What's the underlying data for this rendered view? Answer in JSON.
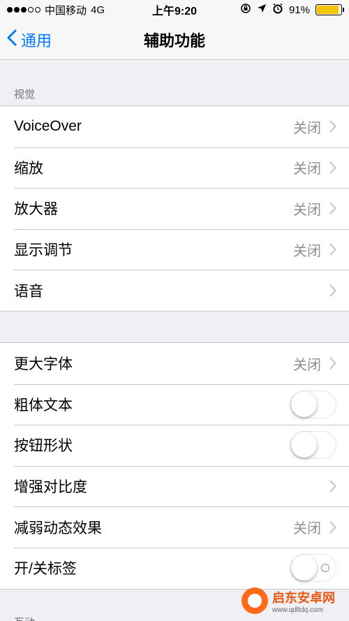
{
  "status_bar": {
    "carrier": "中国移动",
    "network": "4G",
    "time": "上午9:20",
    "battery_percent": "91%",
    "battery_level": 0.91,
    "signal_bars": 3,
    "icons": [
      "orientation-lock-icon",
      "location-arrow-icon",
      "alarm-icon"
    ]
  },
  "nav": {
    "back_label": "通用",
    "title": "辅助功能"
  },
  "sections": [
    {
      "header": "视觉",
      "rows": [
        {
          "label": "VoiceOver",
          "value": "关闭",
          "accessory": "chevron"
        },
        {
          "label": "缩放",
          "value": "关闭",
          "accessory": "chevron"
        },
        {
          "label": "放大器",
          "value": "关闭",
          "accessory": "chevron"
        },
        {
          "label": "显示调节",
          "value": "关闭",
          "accessory": "chevron"
        },
        {
          "label": "语音",
          "value": "",
          "accessory": "chevron"
        }
      ]
    },
    {
      "header": "",
      "rows": [
        {
          "label": "更大字体",
          "value": "关闭",
          "accessory": "chevron"
        },
        {
          "label": "粗体文本",
          "accessory": "switch",
          "on": false
        },
        {
          "label": "按钮形状",
          "accessory": "switch",
          "on": false
        },
        {
          "label": "增强对比度",
          "value": "",
          "accessory": "chevron"
        },
        {
          "label": "减弱动态效果",
          "value": "关闭",
          "accessory": "chevron"
        },
        {
          "label": "开/关标签",
          "accessory": "switch",
          "on": false
        }
      ]
    },
    {
      "header": "互动",
      "rows": []
    }
  ],
  "watermark": {
    "name": "启东安卓网",
    "url": "www.qdltdq.com"
  },
  "colors": {
    "accent": "#007aff",
    "background": "#efeff4",
    "secondary_text": "#8e8e93",
    "battery": "#f5c400"
  }
}
